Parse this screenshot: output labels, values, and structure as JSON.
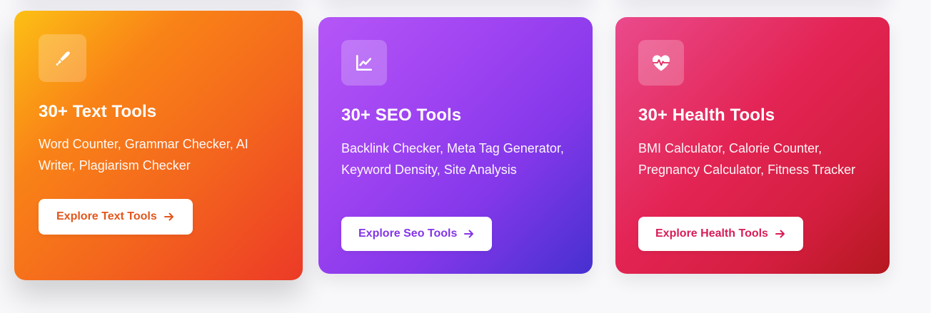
{
  "cards": [
    {
      "title": "30+ Text Tools",
      "description": "Word Counter, Grammar Checker, AI Writer, Plagiarism Checker",
      "button_label": "Explore Text Tools",
      "icon": "pen-nib-icon",
      "accent": "#e2561c"
    },
    {
      "title": "30+ SEO Tools",
      "description": "Backlink Checker, Meta Tag Generator, Keyword Density, Site Analysis",
      "button_label": "Explore Seo Tools",
      "icon": "chart-line-icon",
      "accent": "#8435e6"
    },
    {
      "title": "30+ Health Tools",
      "description": "BMI Calculator, Calorie Counter, Pregnancy Calculator, Fitness Tracker",
      "button_label": "Explore Health Tools",
      "icon": "heart-pulse-icon",
      "accent": "#d91c57"
    }
  ]
}
